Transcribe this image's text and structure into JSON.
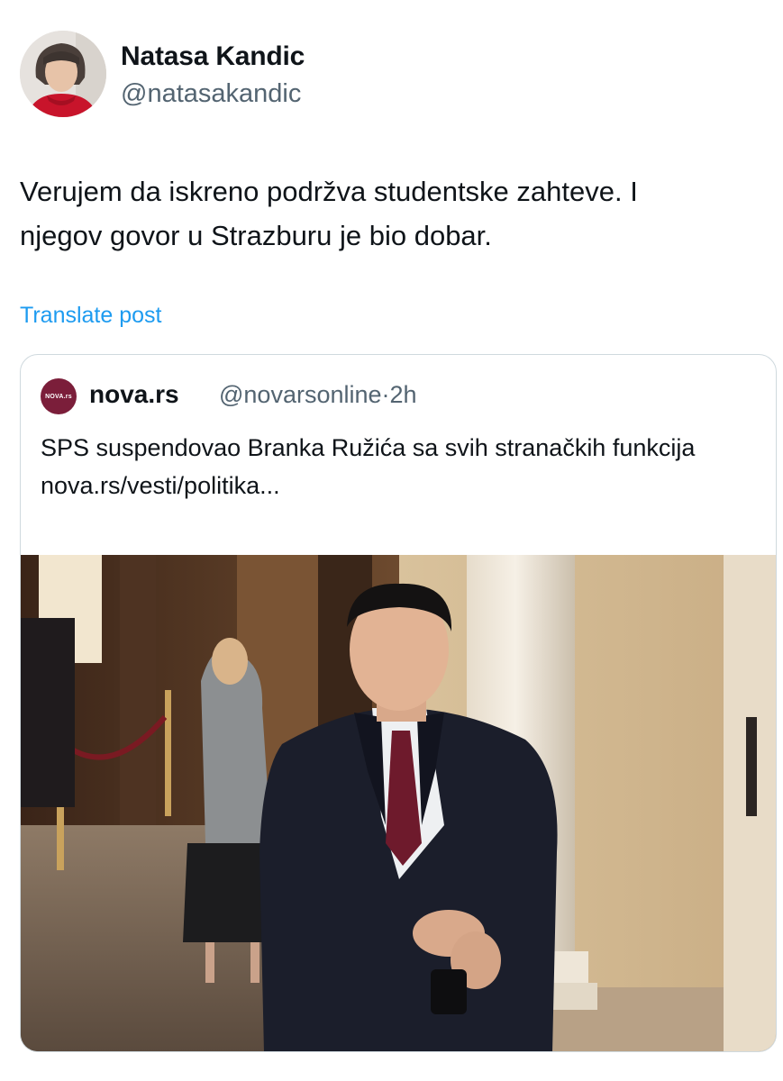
{
  "author": {
    "name": "Natasa Kandic",
    "handle": "@natasakandic"
  },
  "post": {
    "text": "Verujem da iskreno podržva studentske zahteve. I\nnjegov govor u Strazburu  je bio dobar.",
    "translate_label": "Translate post"
  },
  "quoted_post": {
    "logo_text": "NOVA.rs",
    "name": "nova.rs",
    "handle": "@novarsonline",
    "separator": "·",
    "time": "2h",
    "text": "SPS suspendovao Branka Ružića sa svih stranačkih funkcija",
    "link": "nova.rs/vesti/politika..."
  },
  "colors": {
    "text": "#0f1419",
    "secondary": "#536471",
    "link": "#1d9bf0",
    "border": "#cfd9de",
    "nova_brand": "#7b1e3a"
  }
}
